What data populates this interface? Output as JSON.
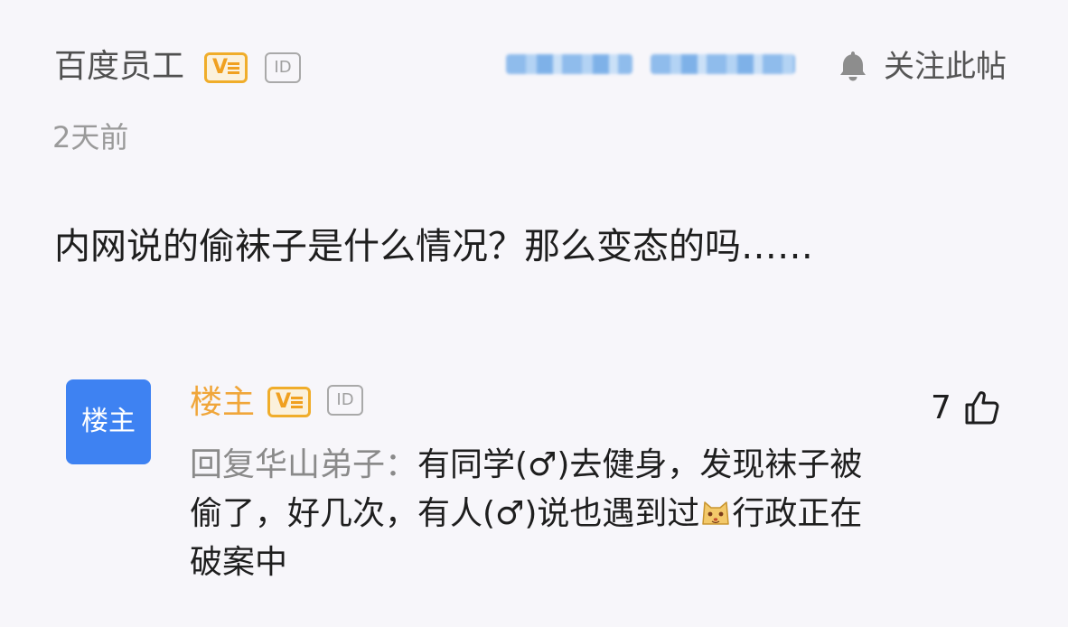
{
  "post": {
    "author": "百度员工",
    "verified_badge": "V",
    "id_badge": "ID",
    "follow_label": "关注此帖",
    "time": "2天前",
    "content": "内网说的偷袜子是什么情况？那么变态的吗……"
  },
  "reply": {
    "avatar_text": "楼主",
    "author": "楼主",
    "verified_badge": "V",
    "id_badge": "ID",
    "likes": "7",
    "prefix": "回复华山弟子：",
    "line1": "有同学(♂)去健身，发现袜子被",
    "line2a": "偷了，好几次，有人(♂)说也遇到过",
    "line2b": "行政正在",
    "line3": "破案中"
  },
  "icons": {
    "bell": "bell-icon",
    "thumb": "thumbs-up-icon",
    "emoji": "cat-emoji-icon"
  },
  "colors": {
    "background": "#f7f6fa",
    "badge_gold": "#f0ad2a",
    "reply_author": "#f0a63a",
    "avatar_blue": "#3e82f2"
  }
}
